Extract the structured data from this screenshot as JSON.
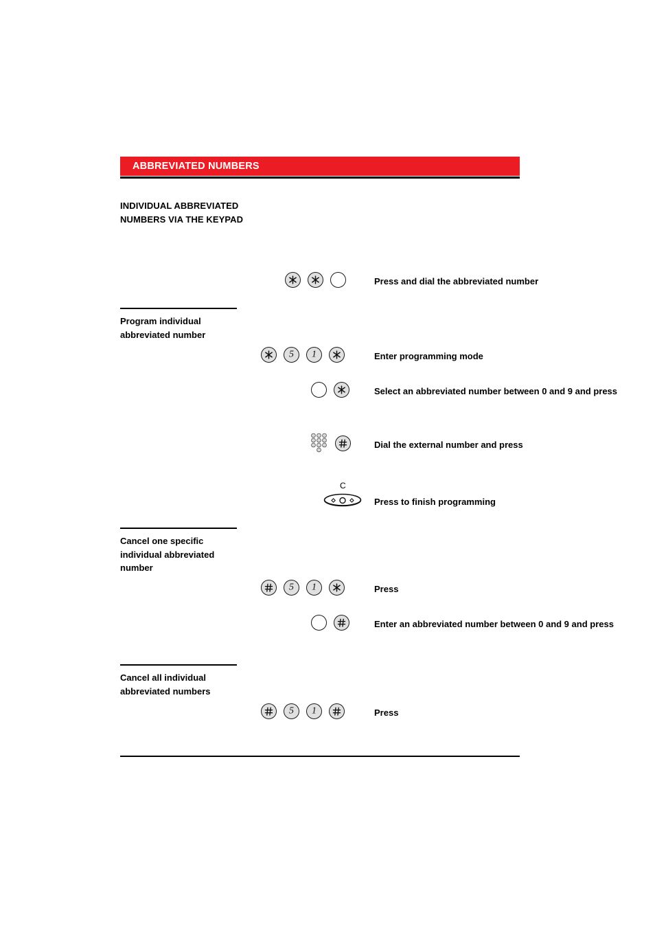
{
  "document": {
    "banner_title": "ABBREVIATED NUMBERS",
    "accent_color": "#ec1c24",
    "main_heading": "INDIVIDUAL ABBREVIATED NUMBERS VIA THE KEYPAD"
  },
  "sections": [
    {
      "heading": null,
      "steps": [
        {
          "keys": [
            "star-key",
            "star-key",
            "blank-key"
          ],
          "instruction": "Press and dial the abbreviated number"
        }
      ]
    },
    {
      "heading": "Program individual abbreviated number",
      "steps": [
        {
          "keys": [
            "star-key",
            "digit-5-key",
            "digit-1-key",
            "star-key"
          ],
          "instruction": "Enter programming mode"
        },
        {
          "keys": [
            "blank-key",
            "star-key"
          ],
          "instruction": "Select an abbreviated number between 0 and 9 and press"
        },
        {
          "keys": [
            "keypad-icon",
            "hash-key"
          ],
          "instruction": "Dial the external number and press"
        },
        {
          "keys": [
            "c-rocker-key"
          ],
          "instruction": "Press to finish programming"
        }
      ]
    },
    {
      "heading": "Cancel one specific individual abbreviated number",
      "steps": [
        {
          "keys": [
            "hash-key",
            "digit-5-key",
            "digit-1-key",
            "star-key"
          ],
          "instruction": "Press"
        },
        {
          "keys": [
            "blank-key",
            "hash-key"
          ],
          "instruction": "Enter an abbreviated number between 0 and 9 and press"
        }
      ]
    },
    {
      "heading": "Cancel all individual abbreviated numbers",
      "steps": [
        {
          "keys": [
            "hash-key",
            "digit-5-key",
            "digit-1-key",
            "hash-key"
          ],
          "instruction": "Press"
        }
      ]
    }
  ],
  "key_labels": {
    "star": "✳",
    "hash": "#",
    "digit_5": "5",
    "digit_1": "1",
    "c_label": "C"
  }
}
